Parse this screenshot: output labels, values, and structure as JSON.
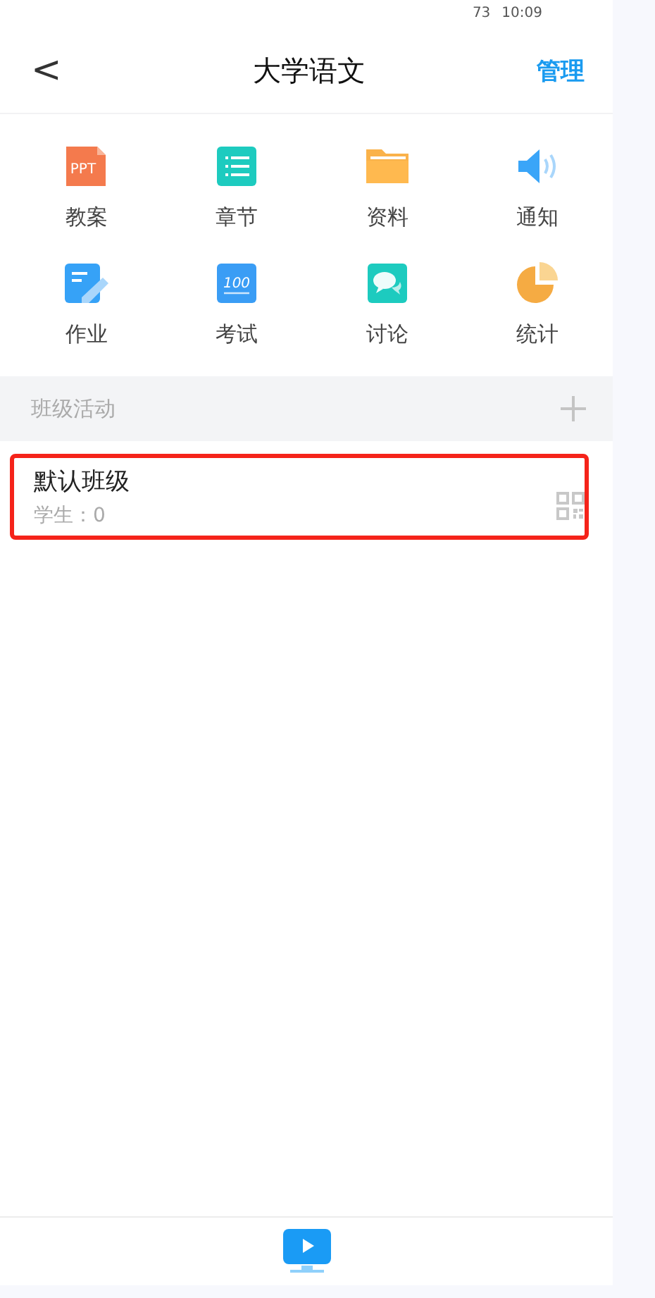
{
  "status_bar": {
    "battery": "73",
    "time": "10:09"
  },
  "header": {
    "back": "<",
    "title": "大学语文",
    "action": "管理"
  },
  "features": [
    {
      "kind": "ppt",
      "label": "教案",
      "icon_text": "PPT"
    },
    {
      "kind": "list",
      "label": "章节"
    },
    {
      "kind": "folder",
      "label": "资料"
    },
    {
      "kind": "speaker",
      "label": "通知"
    },
    {
      "kind": "edit",
      "label": "作业"
    },
    {
      "kind": "score",
      "label": "考试",
      "icon_text": "100"
    },
    {
      "kind": "chat",
      "label": "讨论"
    },
    {
      "kind": "pie",
      "label": "统计"
    }
  ],
  "section": {
    "title": "班级活动"
  },
  "classes": [
    {
      "name": "默认班级",
      "students": "学生：0",
      "highlighted": true
    }
  ]
}
